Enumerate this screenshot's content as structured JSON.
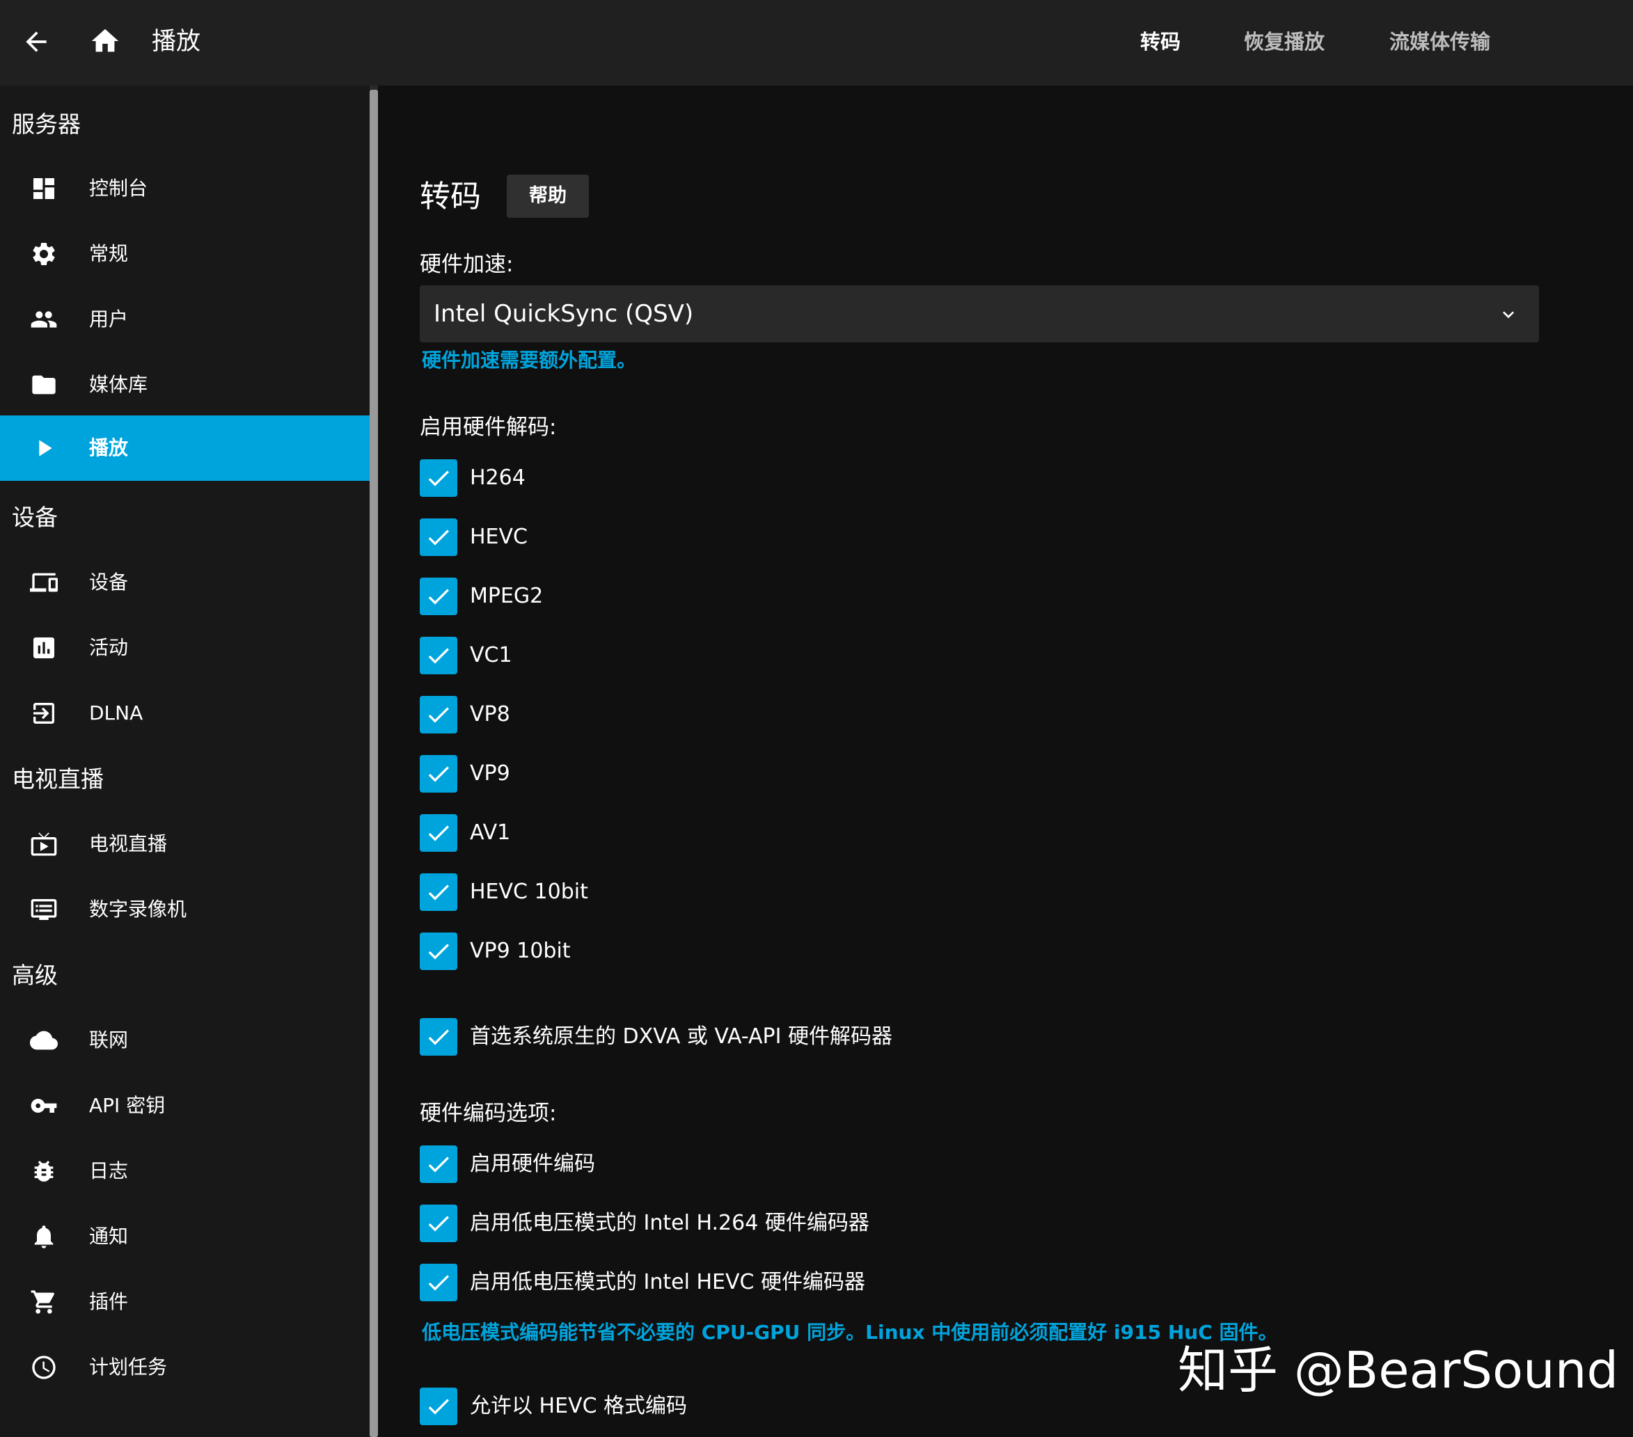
{
  "header": {
    "title": "播放",
    "tabs": [
      {
        "label": "转码",
        "active": true
      },
      {
        "label": "恢复播放",
        "active": false
      },
      {
        "label": "流媒体传输",
        "active": false
      }
    ]
  },
  "sidebar": {
    "sections": [
      {
        "title": "服务器",
        "items": [
          {
            "label": "控制台",
            "icon": "dashboard-icon"
          },
          {
            "label": "常规",
            "icon": "gear-icon"
          },
          {
            "label": "用户",
            "icon": "users-icon"
          },
          {
            "label": "媒体库",
            "icon": "folder-icon"
          },
          {
            "label": "播放",
            "icon": "play-icon",
            "active": true
          }
        ]
      },
      {
        "title": "设备",
        "items": [
          {
            "label": "设备",
            "icon": "devices-icon"
          },
          {
            "label": "活动",
            "icon": "activity-icon"
          },
          {
            "label": "DLNA",
            "icon": "dlna-icon"
          }
        ]
      },
      {
        "title": "电视直播",
        "items": [
          {
            "label": "电视直播",
            "icon": "live-tv-icon"
          },
          {
            "label": "数字录像机",
            "icon": "dvr-icon"
          }
        ]
      },
      {
        "title": "高级",
        "items": [
          {
            "label": "联网",
            "icon": "cloud-icon"
          },
          {
            "label": "API 密钥",
            "icon": "key-icon"
          },
          {
            "label": "日志",
            "icon": "bug-icon"
          },
          {
            "label": "通知",
            "icon": "bell-icon"
          },
          {
            "label": "插件",
            "icon": "cart-icon"
          },
          {
            "label": "计划任务",
            "icon": "clock-icon"
          }
        ]
      }
    ]
  },
  "main": {
    "heading": "转码",
    "help_label": "帮助",
    "hw_accel_label": "硬件加速:",
    "hw_accel_value": "Intel QuickSync (QSV)",
    "hw_accel_note": "硬件加速需要额外配置。",
    "decode_label": "启用硬件解码:",
    "decode_codecs": [
      {
        "label": "H264",
        "checked": true
      },
      {
        "label": "HEVC",
        "checked": true
      },
      {
        "label": "MPEG2",
        "checked": true
      },
      {
        "label": "VC1",
        "checked": true
      },
      {
        "label": "VP8",
        "checked": true
      },
      {
        "label": "VP9",
        "checked": true
      },
      {
        "label": "AV1",
        "checked": true
      },
      {
        "label": "HEVC 10bit",
        "checked": true
      },
      {
        "label": "VP9 10bit",
        "checked": true
      }
    ],
    "prefer_native_label": "首选系统原生的 DXVA 或 VA-API 硬件解码器",
    "encode_label": "硬件编码选项:",
    "encode_options": [
      {
        "label": "启用硬件编码",
        "checked": true
      },
      {
        "label": "启用低电压模式的 Intel H.264 硬件编码器",
        "checked": true
      },
      {
        "label": "启用低电压模式的 Intel HEVC 硬件编码器",
        "checked": true
      }
    ],
    "low_power_note": "低电压模式编码能节省不必要的 CPU-GPU 同步。Linux 中使用前必须配置好 i915 HuC 固件。",
    "allow_hevc_label": "允许以 HEVC 格式编码"
  },
  "watermark": "知乎 @BearSound",
  "colors": {
    "accent": "#00a4dc",
    "background": "#101010",
    "topbar": "#202020",
    "sidebar": "#181818"
  }
}
